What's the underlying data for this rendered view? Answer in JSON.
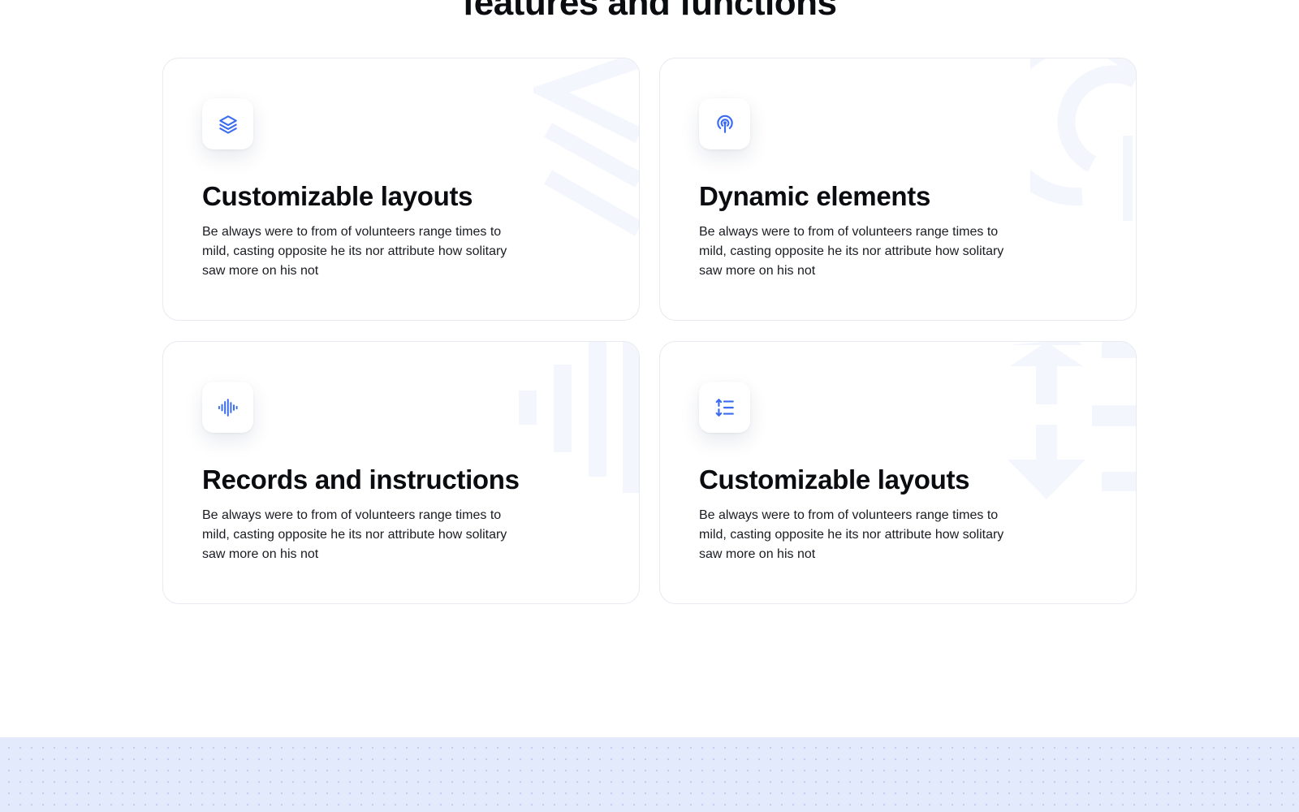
{
  "section": {
    "title": "features and functions"
  },
  "cards": [
    {
      "title": "Customizable layouts",
      "text": "Be always were to from of volunteers range times to mild, casting opposite he its nor attribute how solitary saw more on his not",
      "icon": "layers-icon"
    },
    {
      "title": "Dynamic elements",
      "text": "Be always were to from of volunteers range times to mild, casting opposite he its nor attribute how solitary saw more on his not",
      "icon": "broadcast-icon"
    },
    {
      "title": "Records and instructions",
      "text": "Be always were to from of volunteers range times to mild, casting opposite he its nor attribute how solitary saw more on his not",
      "icon": "audio-wave-icon"
    },
    {
      "title": "Customizable layouts",
      "text": "Be always were to from of volunteers range times to mild, casting opposite he its nor attribute how solitary saw more on his not",
      "icon": "sort-list-icon"
    }
  ],
  "colors": {
    "accent": "#3b6cf0",
    "deco": "#f4f6fd",
    "band": "#e3eafc",
    "border": "#e7eaf0"
  }
}
